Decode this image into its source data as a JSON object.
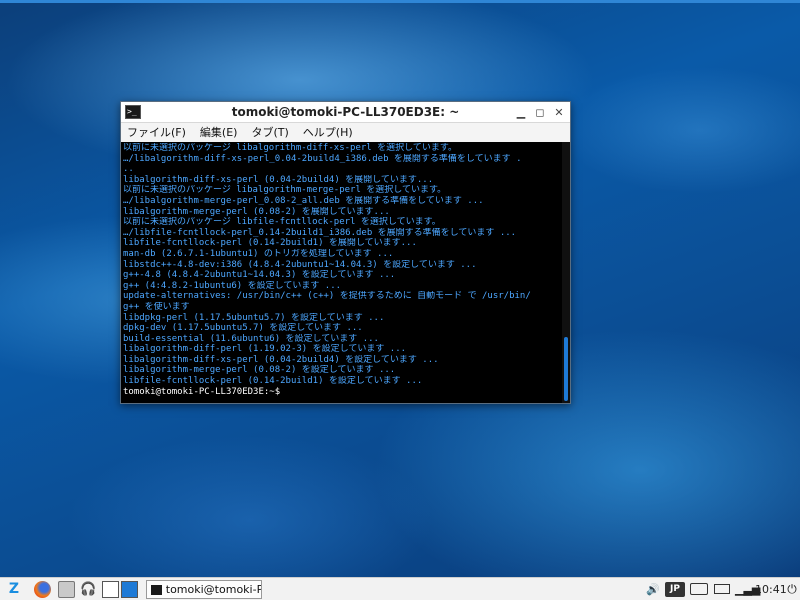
{
  "window": {
    "title": "tomoki@tomoki-PC-LL370ED3E: ~",
    "controls": {
      "minimize": "▁",
      "maximize": "◻",
      "close": "✕"
    }
  },
  "menu": [
    "ファイル(F)",
    "編集(E)",
    "タブ(T)",
    "ヘルプ(H)"
  ],
  "terminal": {
    "lines": [
      "以前に未選択のパッケージ libalgorithm-diff-xs-perl を選択しています。",
      "…/libalgorithm-diff-xs-perl_0.04-2build4_i386.deb を展開する準備をしています .",
      "..",
      "libalgorithm-diff-xs-perl (0.04-2build4) を展開しています...",
      "以前に未選択のパッケージ libalgorithm-merge-perl を選択しています。",
      "…/libalgorithm-merge-perl_0.08-2_all.deb を展開する準備をしています ...",
      "libalgorithm-merge-perl (0.08-2) を展開しています...",
      "以前に未選択のパッケージ libfile-fcntllock-perl を選択しています。",
      "…/libfile-fcntllock-perl_0.14-2build1_i386.deb を展開する準備をしています ...",
      "libfile-fcntllock-perl (0.14-2build1) を展開しています...",
      "man-db (2.6.7.1-1ubuntu1) のトリガを処理しています ...",
      "libstdc++-4.8-dev:i386 (4.8.4-2ubuntu1~14.04.3) を設定しています ...",
      "g++-4.8 (4.8.4-2ubuntu1~14.04.3) を設定しています ...",
      "g++ (4:4.8.2-1ubuntu6) を設定しています ...",
      "update-alternatives: /usr/bin/c++ (c++) を提供するために 自動モード で /usr/bin/",
      "g++ を使います",
      "libdpkg-perl (1.17.5ubuntu5.7) を設定しています ...",
      "dpkg-dev (1.17.5ubuntu5.7) を設定しています ...",
      "build-essential (11.6ubuntu6) を設定しています ...",
      "libalgorithm-diff-perl (1.19.02-3) を設定しています ...",
      "libalgorithm-diff-xs-perl (0.04-2build4) を設定しています ...",
      "libalgorithm-merge-perl (0.08-2) を設定しています ...",
      "libfile-fcntllock-perl (0.14-2build1) を設定しています ..."
    ],
    "prompt": "tomoki@tomoki-PC-LL370ED3E:~$",
    "text_color": "#4da7ff"
  },
  "taskbar": {
    "start_label": "Z",
    "task_label": "tomoki@tomoki-P...",
    "ime": "JP",
    "clock": "10:41",
    "icons": [
      "start-menu-icon",
      "firefox-icon",
      "file-manager-icon",
      "headphones-icon",
      "desktop-1-icon",
      "desktop-2-icon",
      "volume-icon",
      "keyboard-icon",
      "battery-icon",
      "signal-icon",
      "power-icon"
    ]
  }
}
